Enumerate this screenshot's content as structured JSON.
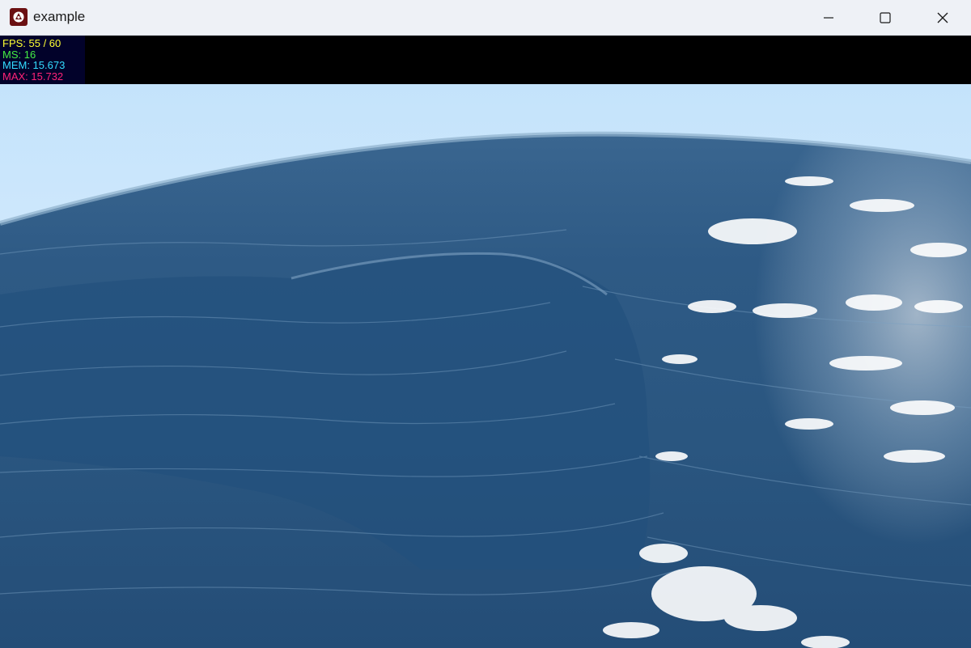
{
  "window": {
    "title": "example",
    "icon": "app-logo-icon",
    "controls": {
      "minimize": "minimize-icon",
      "maximize": "maximize-icon",
      "close": "close-icon"
    }
  },
  "stats": {
    "fps": "FPS: 55 / 60",
    "ms": "MS: 16",
    "mem": "MEM: 15.673",
    "max": "MAX: 15.732",
    "colors": {
      "fps": "#ffff33",
      "ms": "#44ee44",
      "mem": "#33ddff",
      "max": "#ff2277"
    }
  },
  "scene": {
    "description_colors": {
      "sky_top": "#c9e6fb",
      "sky_horizon": "#eef7ff",
      "ocean_deep": "#1e4a74",
      "ocean_mid": "#3f6d96",
      "foam": "#ffffff"
    }
  }
}
